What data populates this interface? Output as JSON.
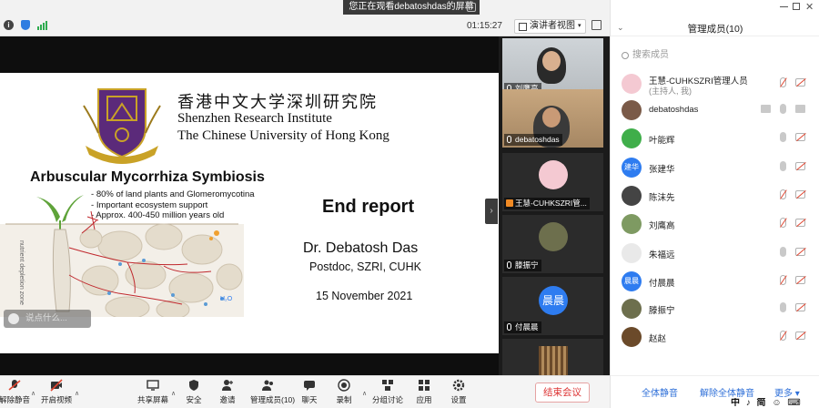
{
  "banner": {
    "text": "您正在观看debatoshdas的屏幕"
  },
  "status": {
    "timer": "01:15:27",
    "view_label": "演讲者视图"
  },
  "slide": {
    "inst_cn": "香港中文大学深圳研究院",
    "inst_en_1": "Shenzhen Research Institute",
    "inst_en_2": "The Chinese University of Hong Kong",
    "symbiosis_title": "Arbuscular Mycorrhiza Symbiosis",
    "bullets": [
      "80% of land plants and Glomeromycotina",
      "Important ecosystem support",
      "Approx. 400-450 million years old"
    ],
    "side_label": "nutrient depletion zone",
    "chem_label": "H₂O",
    "title": "End report",
    "author": "Dr. Debatosh Das",
    "affiliation": "Postdoc, SZRI, CUHK",
    "date": "15 November 2021",
    "chat_placeholder": "说点什么..."
  },
  "videos": [
    {
      "name": "刘鹰高"
    },
    {
      "name": "debatoshdas"
    },
    {
      "name": "王慧-CUHKSZRI管..."
    },
    {
      "name": "滕振宁"
    },
    {
      "name": "付晨晨",
      "avatar_text": "晨晨"
    }
  ],
  "panel": {
    "title": "管理成员(10)",
    "search_placeholder": "搜索成员",
    "members": [
      {
        "name": "王慧-CUHKSZRI管理人员",
        "role": "(主持人, 我)"
      },
      {
        "name": "debatoshdas"
      },
      {
        "name": "叶能辉"
      },
      {
        "name": "张建华",
        "avatar_text": "建华"
      },
      {
        "name": "陈沫先"
      },
      {
        "name": "刘鹰高"
      },
      {
        "name": "朱福远"
      },
      {
        "name": "付晨晨",
        "avatar_text": "晨晨"
      },
      {
        "name": "滕振宁"
      },
      {
        "name": "赵赵"
      }
    ],
    "mute_all": "全体静音",
    "unmute_all": "解除全体静音",
    "more": "更多 ▾",
    "ime_text": "中 ♪ 简 ☺ ⌨"
  },
  "toolbar": {
    "unmute": "解除静音",
    "start_video": "开启视频",
    "share_screen": "共享屏幕",
    "security": "安全",
    "invite": "邀请",
    "manage_members": "管理成员(10)",
    "chat": "聊天",
    "record": "录制",
    "breakout": "分组讨论",
    "apps": "应用",
    "settings": "设置",
    "end_meeting": "结束会议"
  },
  "colors": {
    "accent": "#2e6fd8",
    "danger": "#d33333",
    "brand_purple": "#5b2a7a",
    "brand_gold": "#c9a227"
  }
}
